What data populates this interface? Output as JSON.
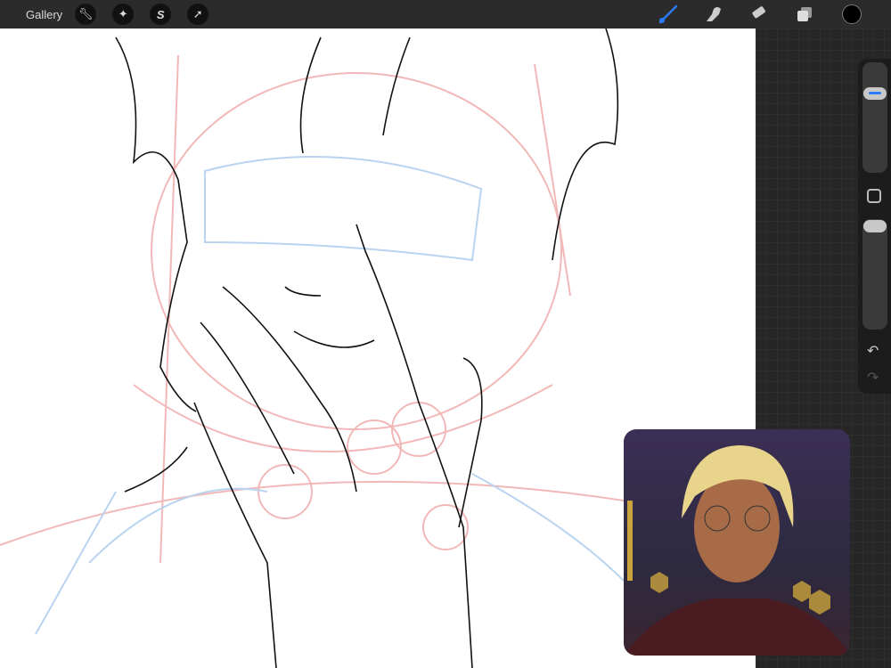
{
  "topbar": {
    "gallery_label": "Gallery",
    "left_tools": [
      {
        "icon": "wrench-icon",
        "name": "actions"
      },
      {
        "icon": "magic-wand-icon",
        "name": "adjustments"
      },
      {
        "icon": "selection-icon",
        "name": "selection"
      },
      {
        "icon": "arrow-cursor-icon",
        "name": "transform"
      }
    ],
    "right_tools": [
      {
        "icon": "brush-icon",
        "name": "paint",
        "active": true
      },
      {
        "icon": "smudge-icon",
        "name": "smudge"
      },
      {
        "icon": "eraser-icon",
        "name": "erase"
      },
      {
        "icon": "layers-icon",
        "name": "layers"
      }
    ],
    "current_color": "#000000",
    "accent": "#2a7bf5"
  },
  "sidebar": {
    "brush_size": 0.75,
    "opacity": 1.0,
    "undo_icon": "undo-icon",
    "redo_icon": "redo-icon"
  },
  "reference": {
    "label": "Reference image"
  }
}
